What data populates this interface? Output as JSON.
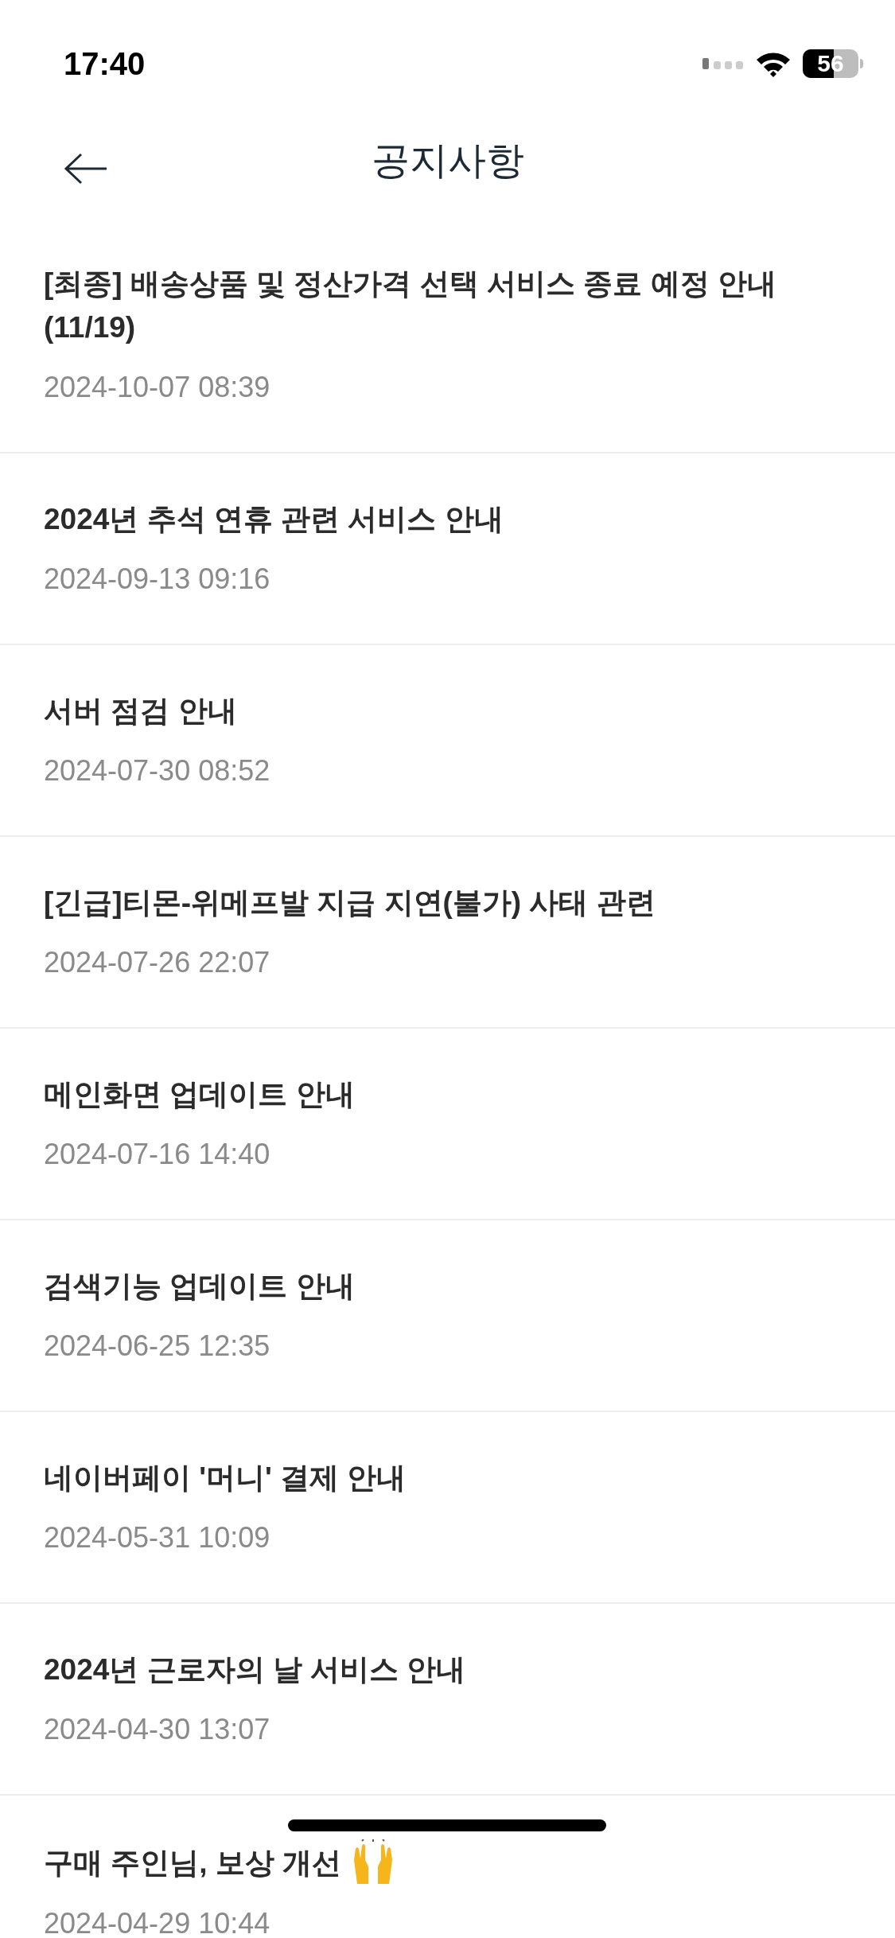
{
  "status_bar": {
    "time": "17:40",
    "battery": "56"
  },
  "header": {
    "title": "공지사항"
  },
  "notices": [
    {
      "title": "[최종] 배송상품 및 정산가격 선택 서비스 종료 예정 안내 (11/19)",
      "date": "2024-10-07 08:39"
    },
    {
      "title": "2024년 추석 연휴 관련 서비스 안내",
      "date": "2024-09-13 09:16"
    },
    {
      "title": "서버 점검 안내",
      "date": "2024-07-30 08:52"
    },
    {
      "title": "[긴급]티몬-위메프발 지급 지연(불가) 사태 관련",
      "date": "2024-07-26 22:07"
    },
    {
      "title": "메인화면 업데이트 안내",
      "date": "2024-07-16 14:40"
    },
    {
      "title": "검색기능 업데이트 안내",
      "date": "2024-06-25 12:35"
    },
    {
      "title": "네이버페이 '머니' 결제 안내",
      "date": "2024-05-31 10:09"
    },
    {
      "title": "2024년 근로자의 날 서비스 안내",
      "date": "2024-04-30 13:07"
    },
    {
      "title": "구매 주인님, 보상 개선",
      "date": "2024-04-29 10:44",
      "kind": "celebrate"
    }
  ]
}
